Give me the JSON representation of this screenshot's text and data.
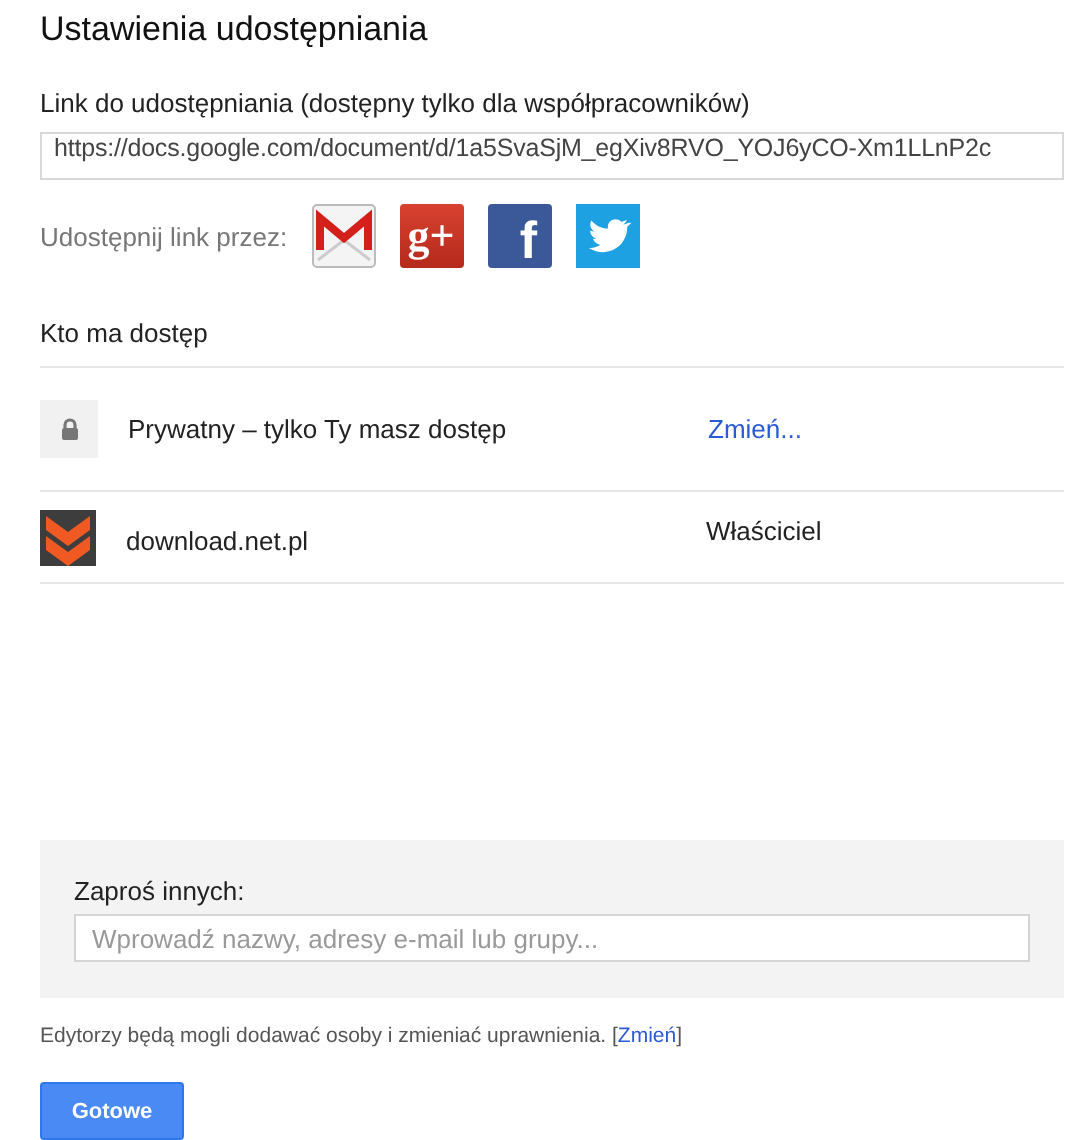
{
  "title": "Ustawienia udostępniania",
  "link_section": {
    "label": "Link do udostępniania (dostępny tylko dla współpracowników)",
    "url": "https://docs.google.com/document/d/1a5SvaSjM_egXiv8RVO_YOJ6yCO-Xm1LLnP2c"
  },
  "share_via": {
    "label": "Udostępnij link przez:",
    "services": [
      {
        "kind": "gmail"
      },
      {
        "kind": "googleplus",
        "glyph": "g+"
      },
      {
        "kind": "facebook",
        "glyph": "f"
      },
      {
        "kind": "twitter"
      }
    ]
  },
  "access": {
    "heading": "Kto ma dostęp",
    "rows": [
      {
        "kind": "visibility",
        "name": "Prywatny – tylko Ty masz dostęp",
        "action": "Zmień..."
      },
      {
        "kind": "owner",
        "name": "download.net.pl",
        "role": "Właściciel"
      }
    ]
  },
  "invite": {
    "label": "Zaproś innych:",
    "placeholder": "Wprowadź nazwy, adresy e-mail lub grupy..."
  },
  "note": {
    "text": "Edytorzy będą mogli dodawać osoby i zmieniać uprawnienia.",
    "before": "[",
    "link": "Zmień",
    "after": "]"
  },
  "done_button": "Gotowe"
}
